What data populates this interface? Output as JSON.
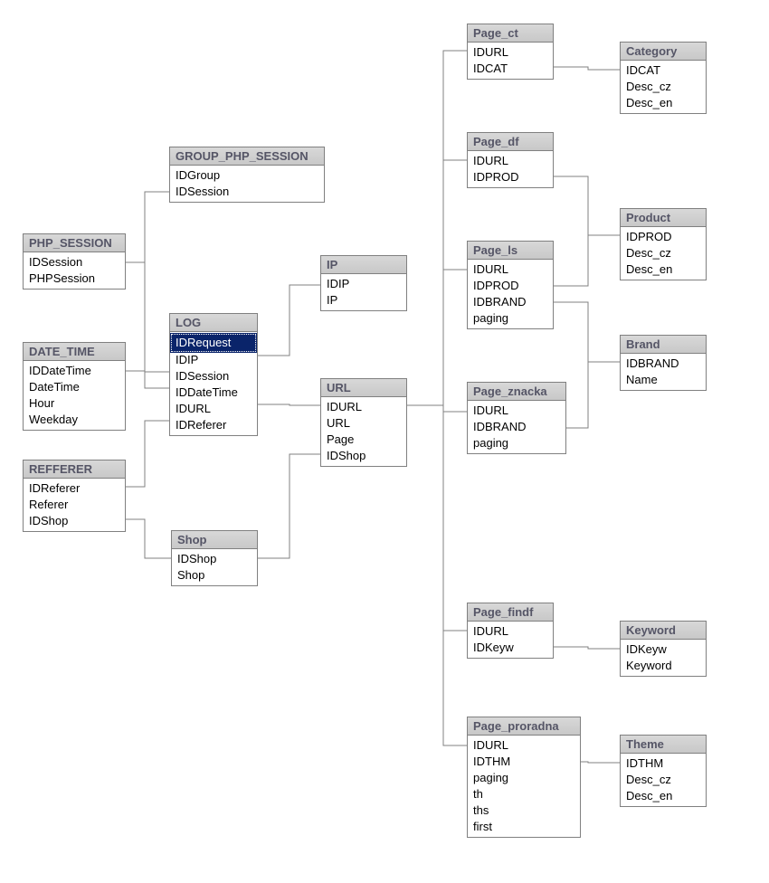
{
  "entities": {
    "php_session": {
      "title": "PHP_SESSION",
      "cols": [
        "IDSession",
        "PHPSession"
      ]
    },
    "group_php_session": {
      "title": "GROUP_PHP_SESSION",
      "cols": [
        "IDGroup",
        "IDSession"
      ]
    },
    "date_time": {
      "title": "DATE_TIME",
      "cols": [
        "IDDateTime",
        "DateTime",
        "Hour",
        "Weekday"
      ]
    },
    "refferer": {
      "title": "REFFERER",
      "cols": [
        "IDReferer",
        "Referer",
        "IDShop"
      ]
    },
    "log": {
      "title": "LOG",
      "cols": [
        "IDRequest",
        "IDIP",
        "IDSession",
        "IDDateTime",
        "IDURL",
        "IDReferer"
      ],
      "selected": 0
    },
    "ip": {
      "title": "IP",
      "cols": [
        "IDIP",
        "IP"
      ]
    },
    "url": {
      "title": "URL",
      "cols": [
        "IDURL",
        "URL",
        "Page",
        "IDShop"
      ]
    },
    "shop": {
      "title": "Shop",
      "cols": [
        "IDShop",
        "Shop"
      ]
    },
    "page_ct": {
      "title": "Page_ct",
      "cols": [
        "IDURL",
        "IDCAT"
      ]
    },
    "category": {
      "title": "Category",
      "cols": [
        "IDCAT",
        "Desc_cz",
        "Desc_en"
      ]
    },
    "page_df": {
      "title": "Page_df",
      "cols": [
        "IDURL",
        "IDPROD"
      ]
    },
    "product": {
      "title": "Product",
      "cols": [
        "IDPROD",
        "Desc_cz",
        "Desc_en"
      ]
    },
    "page_ls": {
      "title": "Page_ls",
      "cols": [
        "IDURL",
        "IDPROD",
        "IDBRAND",
        "paging"
      ]
    },
    "brand": {
      "title": "Brand",
      "cols": [
        "IDBRAND",
        "Name"
      ]
    },
    "page_znacka": {
      "title": "Page_znacka",
      "cols": [
        "IDURL",
        "IDBRAND",
        "paging"
      ]
    },
    "page_findf": {
      "title": "Page_findf",
      "cols": [
        "IDURL",
        "IDKeyw"
      ]
    },
    "keyword": {
      "title": "Keyword",
      "cols": [
        "IDKeyw",
        "Keyword"
      ]
    },
    "page_proradna": {
      "title": "Page_proradna",
      "cols": [
        "IDURL",
        "IDTHM",
        "paging",
        "th",
        "ths",
        "first"
      ]
    },
    "theme": {
      "title": "Theme",
      "cols": [
        "IDTHM",
        "Desc_cz",
        "Desc_en"
      ]
    }
  }
}
